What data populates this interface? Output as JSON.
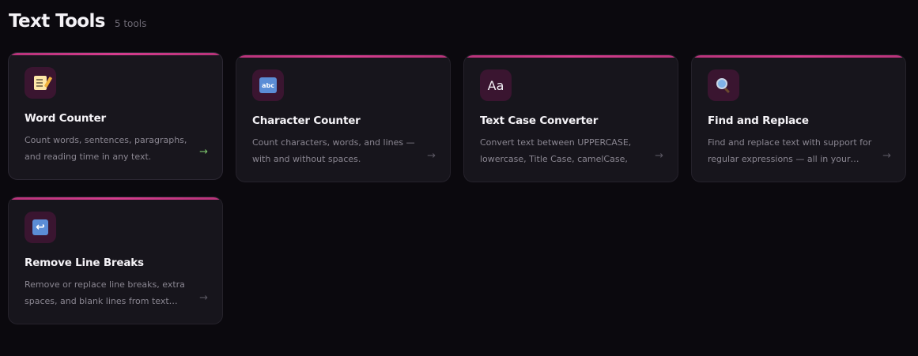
{
  "header": {
    "title": "Text Tools",
    "count": "5 tools"
  },
  "colors": {
    "accent": "#d63d8e",
    "icon_bg": "#3a1530",
    "card_bg": "#17151c",
    "active_arrow": "#7bc26a"
  },
  "tools": [
    {
      "icon": "memo-icon",
      "title": "Word Counter",
      "description": "Count words, sentences, paragraphs, and reading time in any text.",
      "arrow": "→"
    },
    {
      "icon": "abc-icon",
      "title": "Character Counter",
      "description": "Count characters, words, and lines — with and without spaces.",
      "arrow": "→"
    },
    {
      "icon": "text-case-icon",
      "icon_text": "Aa",
      "title": "Text Case Converter",
      "description": "Convert text between UPPERCASE, lowercase, Title Case, camelCase, and…",
      "arrow": "→"
    },
    {
      "icon": "magnifier-icon",
      "title": "Find and Replace",
      "description": "Find and replace text with support for regular expressions — all in your…",
      "arrow": "→"
    },
    {
      "icon": "return-arrow-icon",
      "title": "Remove Line Breaks",
      "description": "Remove or replace line breaks, extra spaces, and blank lines from text…",
      "arrow": "→"
    }
  ]
}
